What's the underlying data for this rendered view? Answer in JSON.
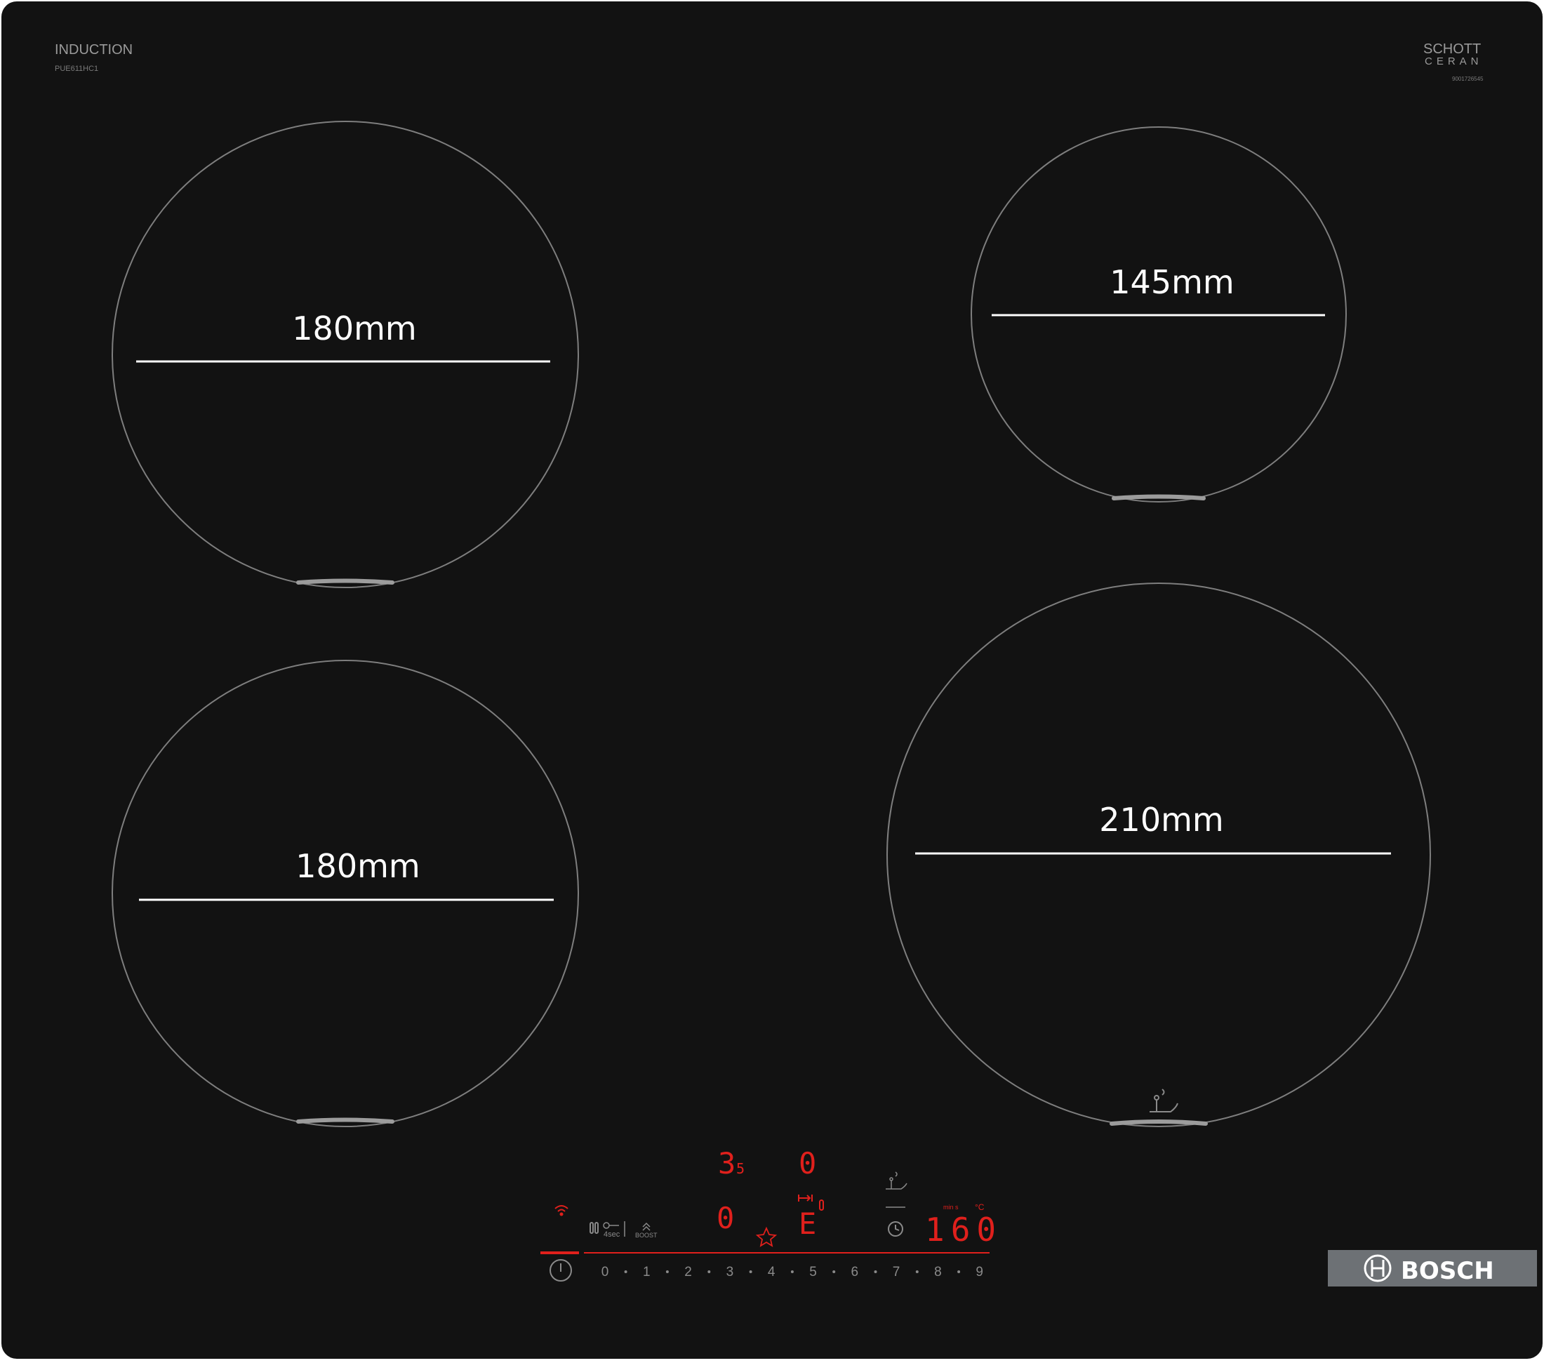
{
  "hob": {
    "type_label": "INDUCTION",
    "model": "PUE611HC1",
    "glass_brand": {
      "line1": "SCHOTT",
      "line2": "CERAN",
      "code": "9001726545"
    },
    "bosch_label": "BOSCH"
  },
  "zones": [
    {
      "id": "front-left",
      "label": "180mm"
    },
    {
      "id": "back-left",
      "label": "180mm"
    },
    {
      "id": "back-right",
      "label": "145mm"
    },
    {
      "id": "front-right",
      "label": "210mm"
    }
  ],
  "control_panel": {
    "displays": {
      "zone_top_left": "3",
      "zone_top_left_sub": "5",
      "zone_top_right": "0",
      "zone_bottom_left": "0",
      "zone_bottom_right": "E",
      "timer": "160",
      "timer_unit": "°C",
      "timer_small_label": "min s"
    },
    "labels": {
      "seconds": "4sec",
      "boost": "BOOST"
    },
    "slider_digits": [
      "0",
      "1",
      "2",
      "3",
      "4",
      "5",
      "6",
      "7",
      "8",
      "9"
    ]
  },
  "colors": {
    "glass": "#121212",
    "indicator_red": "#e0201c",
    "zone_outline": "#8a8a8a",
    "bosch_badge_bg": "#6d7175"
  }
}
